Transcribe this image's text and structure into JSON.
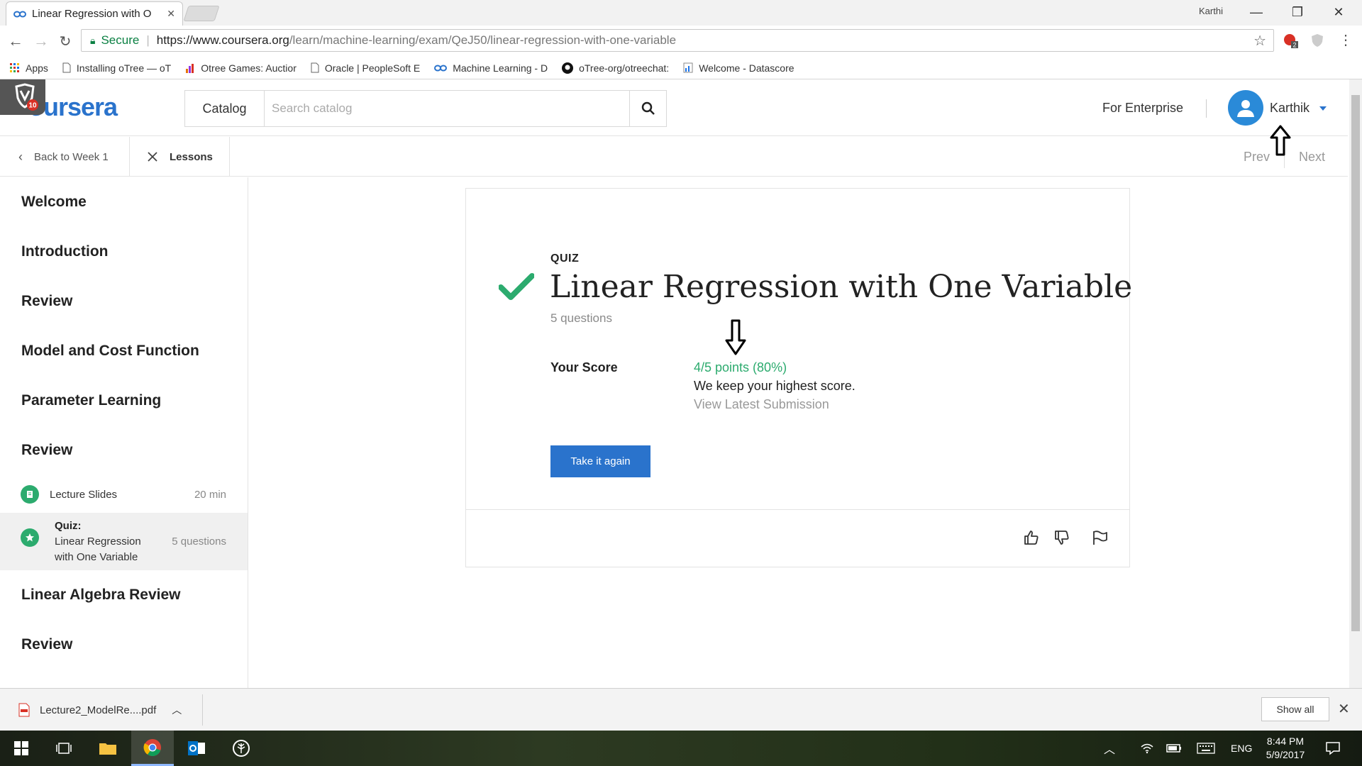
{
  "browser": {
    "tab_title": "Linear Regression with O",
    "window_user": "Karthi",
    "secure_label": "Secure",
    "url_host": "https://www.coursera.org",
    "url_path": "/learn/machine-learning/exam/QeJ50/linear-regression-with-one-variable",
    "bookmarks": [
      {
        "label": "Apps"
      },
      {
        "label": "Installing oTree — oT"
      },
      {
        "label": "Otree Games: Auctior"
      },
      {
        "label": "Oracle | PeopleSoft E"
      },
      {
        "label": "Machine Learning - D"
      },
      {
        "label": "oTree-org/otreechat:"
      },
      {
        "label": "Welcome - Datascore"
      }
    ],
    "extension_badge": "2",
    "shield_badge": "10"
  },
  "header": {
    "logo": "oursera",
    "catalog_label": "Catalog",
    "search_placeholder": "Search catalog",
    "enterprise_label": "For Enterprise",
    "username": "Karthik"
  },
  "subnav": {
    "back_label": "Back to Week 1",
    "lessons_label": "Lessons",
    "prev_label": "Prev",
    "next_label": "Next"
  },
  "sidebar": {
    "sections": [
      {
        "title": "Welcome"
      },
      {
        "title": "Introduction"
      },
      {
        "title": "Review"
      },
      {
        "title": "Model and Cost Function"
      },
      {
        "title": "Parameter Learning"
      },
      {
        "title": "Review"
      },
      {
        "title": "Linear Algebra Review"
      },
      {
        "title": "Review"
      }
    ],
    "items": [
      {
        "label": "Lecture Slides",
        "meta": "20 min"
      },
      {
        "kind": "Quiz:",
        "label_line1": "Linear Regression",
        "label_line2": "with One Variable",
        "meta": "5 questions"
      }
    ]
  },
  "quiz": {
    "type_label": "QUIZ",
    "title": "Linear Regression with One Variable",
    "question_count": "5 questions",
    "score_label": "Your Score",
    "score_value": "4/5 points (80%)",
    "score_note": "We keep your highest score.",
    "view_submission": "View Latest Submission",
    "take_again": "Take it again"
  },
  "downloads": {
    "file_name": "Lecture2_ModelRe....pdf",
    "show_all": "Show all"
  },
  "taskbar": {
    "language": "ENG",
    "time": "8:44 PM",
    "date": "5/9/2017"
  },
  "colors": {
    "accent": "#2a73cc",
    "success": "#2cab6e"
  }
}
